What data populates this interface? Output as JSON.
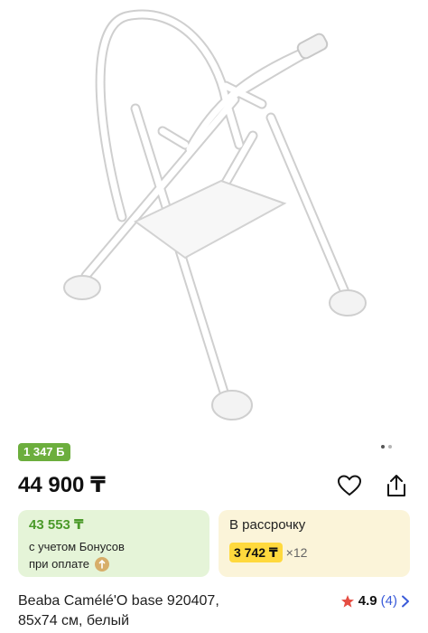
{
  "product": {
    "bonus_badge": "1 347 Б",
    "price": "44 900 ₸",
    "bonus_price": "43 553 ₸",
    "bonus_note_line1": "с учетом Бонусов",
    "bonus_note_line2": "при оплате",
    "installment_title": "В рассрочку",
    "installment_amount": "3 742 ₸",
    "installment_months": "×12",
    "title_line1": "Beaba Camélé'O base 920407,",
    "title_line2": "85x74 см, белый",
    "rating": "4.9",
    "reviews": "(4)"
  },
  "gallery": {
    "total": 2,
    "active": 0
  },
  "icons": {
    "favorite": "heart-outline-icon",
    "share": "share-icon",
    "rating": "star-icon",
    "more": "chevron-right-icon",
    "coin": "bonus-coin-icon"
  },
  "colors": {
    "bonus_green": "#6cae3d",
    "bonus_card_bg": "#e5f4d8",
    "installment_card_bg": "#fbf4d9",
    "installment_highlight": "#ffd93d",
    "star": "#e54d42",
    "link": "#3a5bd9"
  }
}
